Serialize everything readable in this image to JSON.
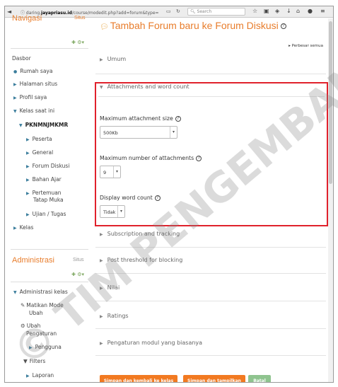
{
  "browser": {
    "url_prefix": "ⓘ daring.",
    "url_domain": "jayapriasu.id",
    "url_rest": "/course/modedit.php?add=forum&type=",
    "search_placeholder": "Search"
  },
  "nav": {
    "navigasi_title": "Navigasi",
    "navigasi_short": "Situs",
    "items": [
      "Dasbor",
      "Rumah saya",
      "Halaman situs",
      "Profil saya",
      "Kelas saat ini",
      "PKNMNJMKMR",
      "Peserta",
      "General",
      "Forum Diskusi",
      "Bahan Ajar",
      "Pertemuan",
      "Tatap Muka",
      "Ujian / Tugas",
      "Kelas"
    ],
    "admin_title": "Administrasi",
    "admin_short": "Situs",
    "admin_items": [
      "Administrasi kelas",
      "Matikan Mode",
      "Ubah",
      "Ubah",
      "Pengaturan",
      "Pengguna",
      "Filters",
      "Laporan"
    ]
  },
  "main": {
    "title": "Tambah Forum baru ke Forum Diskusi",
    "expand_all": "Perbesar semua",
    "sections": {
      "umum": "Umum",
      "attachments": "Attachments and word count",
      "subscription": "Subscription and tracking",
      "post_threshold": "Post threshold for blocking",
      "nilai": "Nilai",
      "ratings": "Ratings",
      "modul": "Pengaturan modul yang biasanya"
    },
    "fields": {
      "max_size_label": "Maximum attachment size",
      "max_size_value": "500Kb",
      "max_num_label": "Maximum number of attachments",
      "max_num_value": "9",
      "word_count_label": "Display word count",
      "word_count_value": "Tidak"
    },
    "buttons": {
      "save_return": "Simpan dan kembali ke kelas",
      "save_display": "Simpan dan tampilkan",
      "cancel": "Batal"
    }
  },
  "watermark": "© TIM PENGEMBANG SD DIKMAS JABAR",
  "colors": {
    "accent": "#e87d2c",
    "highlight_border": "#e0212c",
    "button_orange": "#f27a21",
    "button_green": "#8fc48f",
    "link_blue": "#3a7d9c"
  }
}
